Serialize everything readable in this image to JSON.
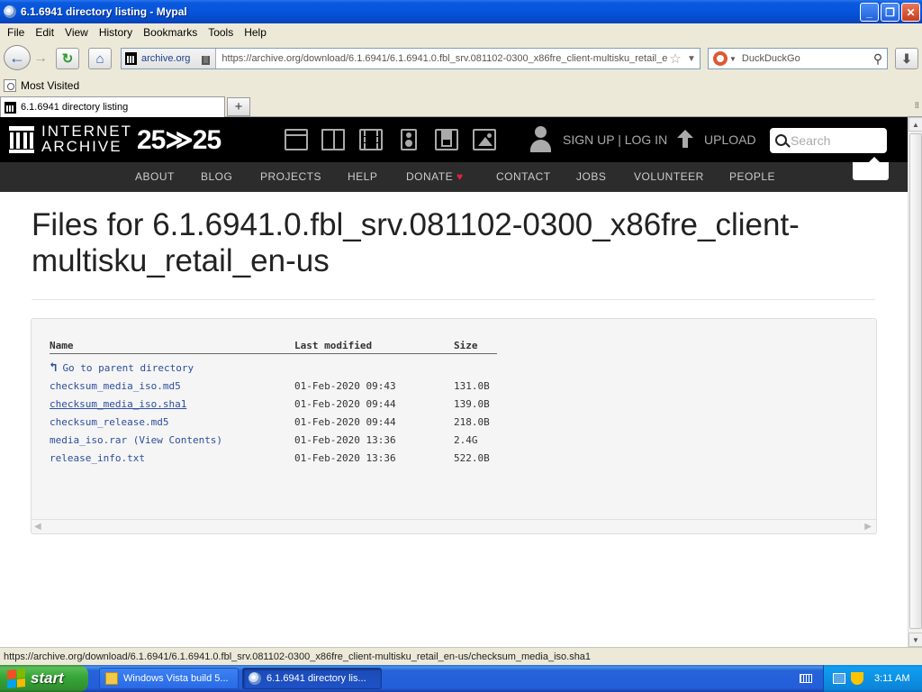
{
  "window": {
    "title": "6.1.6941 directory listing - Mypal",
    "minimize": "_",
    "maximize": "❐",
    "close": "✕"
  },
  "menu": [
    {
      "u": "F",
      "rest": "ile"
    },
    {
      "u": "E",
      "rest": "dit"
    },
    {
      "u": "V",
      "rest": "iew"
    },
    {
      "u": "H",
      "pre": "Hi",
      "rest": "story",
      "full": "History"
    },
    {
      "u": "B",
      "rest": "ookmarks"
    },
    {
      "u": "T",
      "rest": "ools"
    },
    {
      "u": "H",
      "rest": "elp"
    }
  ],
  "menu_labels": [
    "File",
    "Edit",
    "View",
    "History",
    "Bookmarks",
    "Tools",
    "Help"
  ],
  "nav": {
    "site_name": "archive.org",
    "url": "https://archive.org/download/6.1.6941/6.1.6941.0.fbl_srv.081102-0300_x86fre_client-multisku_retail_en-us/",
    "url_display": "https://archive.org/download/6.1.6941/6.1.6941.0.fbl_srv.081102-0300_x86fre_client-multisku_retail_en",
    "search_engine": "DuckDuckGo"
  },
  "bookmarks": {
    "most_visited": "Most Visited"
  },
  "tab": {
    "label": "6.1.6941 directory listing",
    "new_tab": "+"
  },
  "ia": {
    "wordmark_1": "INTERNET",
    "wordmark_2": "ARCHIVE",
    "anniversary": "25≫25",
    "auth": "SIGN UP | LOG IN",
    "upload": "UPLOAD",
    "search_placeholder": "Search",
    "nav": [
      "ABOUT",
      "BLOG",
      "PROJECTS",
      "HELP",
      "DONATE",
      "CONTACT",
      "JOBS",
      "VOLUNTEER",
      "PEOPLE"
    ]
  },
  "page": {
    "title": "Files for 6.1.6941.0.fbl_srv.081102-0300_x86fre_client-multisku_retail_en-us"
  },
  "listing": {
    "headers": {
      "name": "Name",
      "modified": "Last modified",
      "size": "Size"
    },
    "parent": "Go to parent directory",
    "rows": [
      {
        "name": "checksum_media_iso.md5",
        "extra": "",
        "modified": "01-Feb-2020 09:43",
        "size": "131.0B"
      },
      {
        "name": "checksum_media_iso.sha1",
        "extra": "",
        "modified": "01-Feb-2020 09:44",
        "size": "139.0B"
      },
      {
        "name": "checksum_release.md5",
        "extra": "",
        "modified": "01-Feb-2020 09:44",
        "size": "218.0B"
      },
      {
        "name": "media_iso.rar",
        "extra": "(View Contents)",
        "modified": "01-Feb-2020 13:36",
        "size": "2.4G"
      },
      {
        "name": "release_info.txt",
        "extra": "",
        "modified": "01-Feb-2020 13:36",
        "size": "522.0B"
      }
    ]
  },
  "status": "https://archive.org/download/6.1.6941/6.1.6941.0.fbl_srv.081102-0300_x86fre_client-multisku_retail_en-us/checksum_media_iso.sha1",
  "taskbar": {
    "start": "start",
    "tasks": [
      "Windows Vista build 5...",
      "6.1.6941 directory lis..."
    ],
    "clock": "3:11 AM"
  }
}
